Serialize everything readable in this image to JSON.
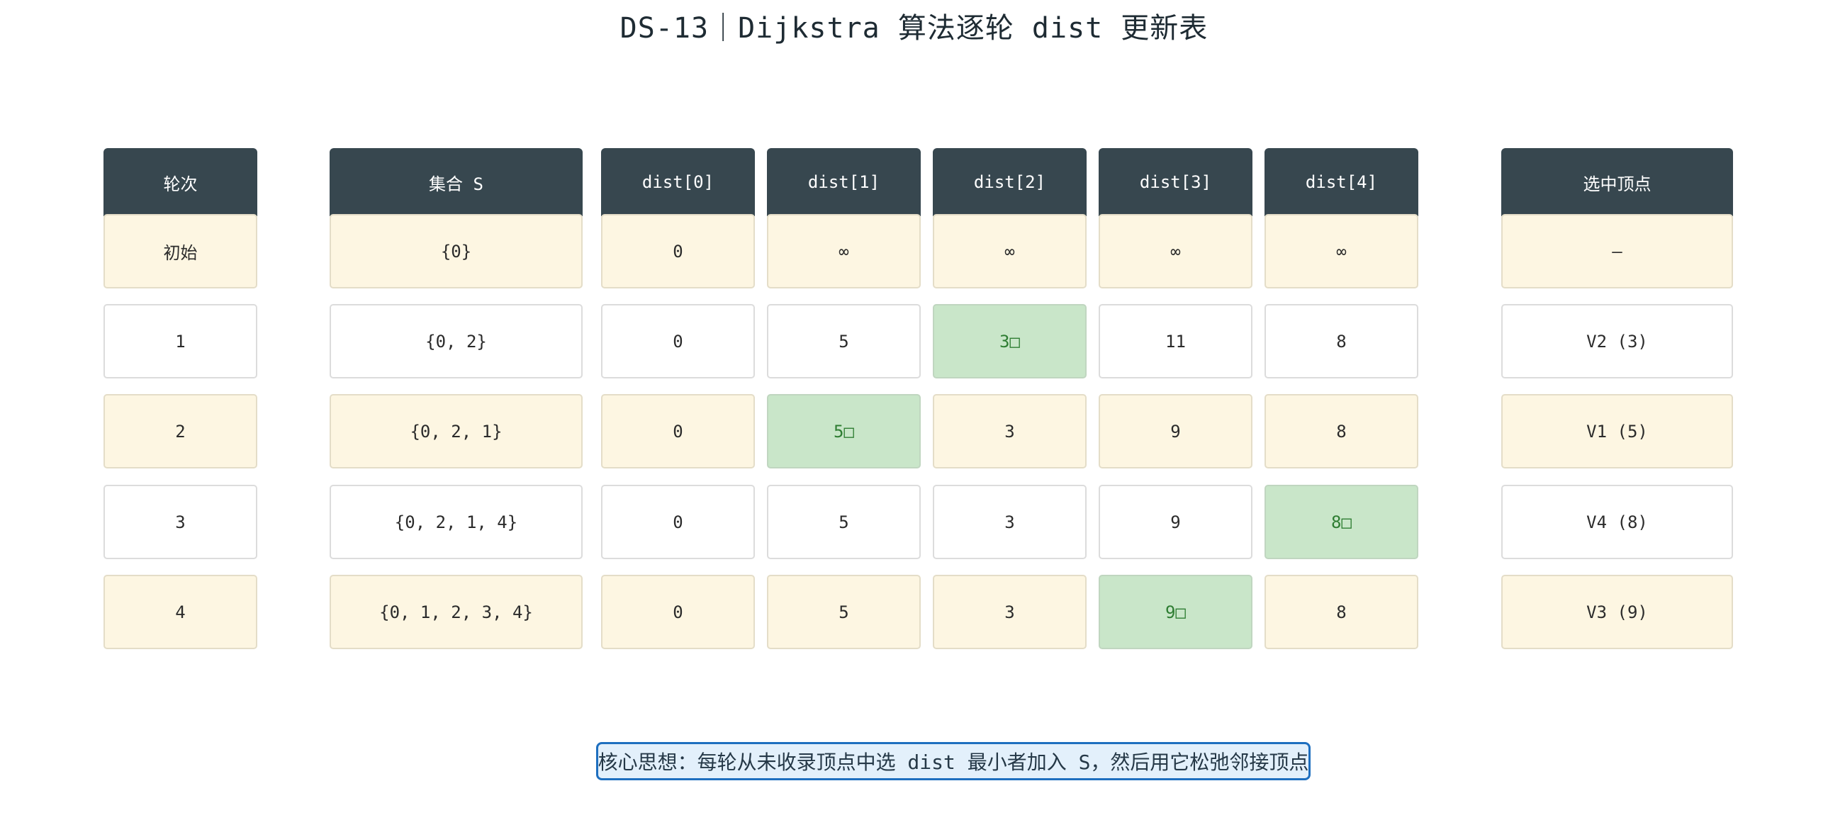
{
  "title": "DS-13｜Dijkstra 算法逐轮 dist 更新表",
  "columns": [
    "轮次",
    "集合 S",
    "dist[0]",
    "dist[1]",
    "dist[2]",
    "dist[3]",
    "dist[4]",
    "选中顶点"
  ],
  "rows": [
    {
      "round": "初始",
      "set": "{0}",
      "dist": [
        "0",
        "∞",
        "∞",
        "∞",
        "∞"
      ],
      "selected": "—",
      "updated": -1
    },
    {
      "round": "1",
      "set": "{0, 2}",
      "dist": [
        "0",
        "5",
        "3□",
        "11",
        "8"
      ],
      "selected": "V2 (3)",
      "updated": 2
    },
    {
      "round": "2",
      "set": "{0, 2, 1}",
      "dist": [
        "0",
        "5□",
        "3",
        "9",
        "8"
      ],
      "selected": "V1 (5)",
      "updated": 1
    },
    {
      "round": "3",
      "set": "{0, 2, 1, 4}",
      "dist": [
        "0",
        "5",
        "3",
        "9",
        "8□"
      ],
      "selected": "V4 (8)",
      "updated": 4
    },
    {
      "round": "4",
      "set": "{0, 1, 2, 3, 4}",
      "dist": [
        "0",
        "5",
        "3",
        "9□",
        "8"
      ],
      "selected": "V3 (9)",
      "updated": 3
    }
  ],
  "note": "核心思想：每轮从未收录顶点中选 dist 最小者加入 S，然后用它松弛邻接顶点",
  "colors": {
    "header": "#37474f",
    "row_alt": "#fdf6e2",
    "row_plain": "#ffffff",
    "highlight": "#c9e6c9",
    "highlight_text": "#2e7d32",
    "note_border": "#1e6fbf",
    "note_bg": "#e3f0fb"
  }
}
